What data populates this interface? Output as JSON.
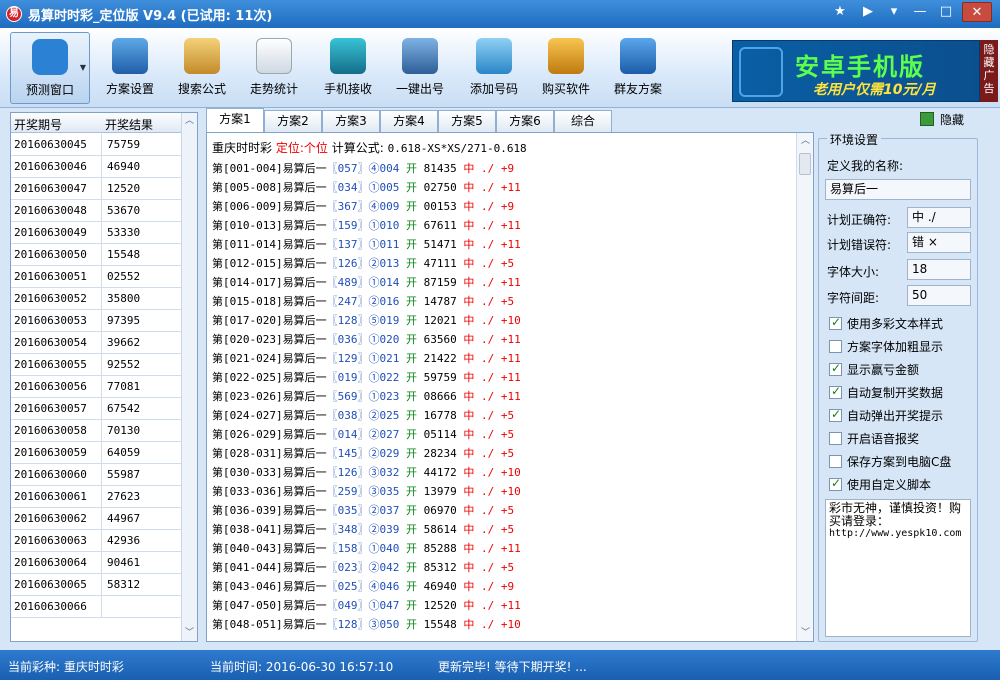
{
  "window": {
    "title": "易算时时彩_定位版 V9.4 (已试用: 11次)",
    "app_icon_glyph": "易"
  },
  "toolbar": {
    "items": [
      {
        "label": "预测窗口",
        "icon": "cloud-icon"
      },
      {
        "label": "方案设置",
        "icon": "settings-screen-icon"
      },
      {
        "label": "搜索公式",
        "icon": "clipboard-search-icon"
      },
      {
        "label": "走势统计",
        "icon": "trend-chart-icon"
      },
      {
        "label": "手机接收",
        "icon": "phone-icon"
      },
      {
        "label": "一键出号",
        "icon": "gear-settings-icon"
      },
      {
        "label": "添加号码",
        "icon": "folder-add-icon"
      },
      {
        "label": "购买软件",
        "icon": "key-icon"
      },
      {
        "label": "群友方案",
        "icon": "users-icon"
      }
    ]
  },
  "ad": {
    "main": "安卓手机版",
    "sub": "老用户仅需10元/月",
    "side": "隐藏广告"
  },
  "left_table": {
    "headers": [
      "开奖期号",
      "开奖结果"
    ],
    "rows": [
      [
        "20160630045",
        "75759"
      ],
      [
        "20160630046",
        "46940"
      ],
      [
        "20160630047",
        "12520"
      ],
      [
        "20160630048",
        "53670"
      ],
      [
        "20160630049",
        "53330"
      ],
      [
        "20160630050",
        "15548"
      ],
      [
        "20160630051",
        "02552"
      ],
      [
        "20160630052",
        "35800"
      ],
      [
        "20160630053",
        "97395"
      ],
      [
        "20160630054",
        "39662"
      ],
      [
        "20160630055",
        "92552"
      ],
      [
        "20160630056",
        "77081"
      ],
      [
        "20160630057",
        "67542"
      ],
      [
        "20160630058",
        "70130"
      ],
      [
        "20160630059",
        "64059"
      ],
      [
        "20160630060",
        "55987"
      ],
      [
        "20160630061",
        "27623"
      ],
      [
        "20160630062",
        "44967"
      ],
      [
        "20160630063",
        "42936"
      ],
      [
        "20160630064",
        "90461"
      ],
      [
        "20160630065",
        "58312"
      ],
      [
        "20160630066",
        ""
      ]
    ]
  },
  "tabs": [
    "方案1",
    "方案2",
    "方案3",
    "方案4",
    "方案5",
    "方案6",
    "综合"
  ],
  "active_tab": 0,
  "hide_label": "隐藏",
  "content": {
    "lottery": "重庆时时彩",
    "position_label": "定位:",
    "position_value": "个位",
    "formula_label": "计算公式:",
    "formula": "0.618-XS*XS/271-0.618",
    "rows": [
      {
        "period": "第[001-004]易算后一",
        "code": "〖057〗④004",
        "kai": "开",
        "num": "81435",
        "zh": "中",
        "mark": "./",
        "pts": "+9"
      },
      {
        "period": "第[005-008]易算后一",
        "code": "〖034〗①005",
        "kai": "开",
        "num": "02750",
        "zh": "中",
        "mark": "./",
        "pts": "+11"
      },
      {
        "period": "第[006-009]易算后一",
        "code": "〖367〗④009",
        "kai": "开",
        "num": "00153",
        "zh": "中",
        "mark": "./",
        "pts": "+9"
      },
      {
        "period": "第[010-013]易算后一",
        "code": "〖159〗①010",
        "kai": "开",
        "num": "67611",
        "zh": "中",
        "mark": "./",
        "pts": "+11"
      },
      {
        "period": "第[011-014]易算后一",
        "code": "〖137〗①011",
        "kai": "开",
        "num": "51471",
        "zh": "中",
        "mark": "./",
        "pts": "+11"
      },
      {
        "period": "第[012-015]易算后一",
        "code": "〖126〗②013",
        "kai": "开",
        "num": "47111",
        "zh": "中",
        "mark": "./",
        "pts": "+5"
      },
      {
        "period": "第[014-017]易算后一",
        "code": "〖489〗①014",
        "kai": "开",
        "num": "87159",
        "zh": "中",
        "mark": "./",
        "pts": "+11"
      },
      {
        "period": "第[015-018]易算后一",
        "code": "〖247〗②016",
        "kai": "开",
        "num": "14787",
        "zh": "中",
        "mark": "./",
        "pts": "+5"
      },
      {
        "period": "第[017-020]易算后一",
        "code": "〖128〗⑤019",
        "kai": "开",
        "num": "12021",
        "zh": "中",
        "mark": "./",
        "pts": "+10"
      },
      {
        "period": "第[020-023]易算后一",
        "code": "〖036〗①020",
        "kai": "开",
        "num": "63560",
        "zh": "中",
        "mark": "./",
        "pts": "+11"
      },
      {
        "period": "第[021-024]易算后一",
        "code": "〖129〗①021",
        "kai": "开",
        "num": "21422",
        "zh": "中",
        "mark": "./",
        "pts": "+11"
      },
      {
        "period": "第[022-025]易算后一",
        "code": "〖019〗①022",
        "kai": "开",
        "num": "59759",
        "zh": "中",
        "mark": "./",
        "pts": "+11"
      },
      {
        "period": "第[023-026]易算后一",
        "code": "〖569〗①023",
        "kai": "开",
        "num": "08666",
        "zh": "中",
        "mark": "./",
        "pts": "+11"
      },
      {
        "period": "第[024-027]易算后一",
        "code": "〖038〗②025",
        "kai": "开",
        "num": "16778",
        "zh": "中",
        "mark": "./",
        "pts": "+5"
      },
      {
        "period": "第[026-029]易算后一",
        "code": "〖014〗②027",
        "kai": "开",
        "num": "05114",
        "zh": "中",
        "mark": "./",
        "pts": "+5"
      },
      {
        "period": "第[028-031]易算后一",
        "code": "〖145〗②029",
        "kai": "开",
        "num": "28234",
        "zh": "中",
        "mark": "./",
        "pts": "+5"
      },
      {
        "period": "第[030-033]易算后一",
        "code": "〖126〗③032",
        "kai": "开",
        "num": "44172",
        "zh": "中",
        "mark": "./",
        "pts": "+10"
      },
      {
        "period": "第[033-036]易算后一",
        "code": "〖259〗③035",
        "kai": "开",
        "num": "13979",
        "zh": "中",
        "mark": "./",
        "pts": "+10"
      },
      {
        "period": "第[036-039]易算后一",
        "code": "〖035〗②037",
        "kai": "开",
        "num": "06970",
        "zh": "中",
        "mark": "./",
        "pts": "+5"
      },
      {
        "period": "第[038-041]易算后一",
        "code": "〖348〗②039",
        "kai": "开",
        "num": "58614",
        "zh": "中",
        "mark": "./",
        "pts": "+5"
      },
      {
        "period": "第[040-043]易算后一",
        "code": "〖158〗①040",
        "kai": "开",
        "num": "85288",
        "zh": "中",
        "mark": "./",
        "pts": "+11"
      },
      {
        "period": "第[041-044]易算后一",
        "code": "〖023〗②042",
        "kai": "开",
        "num": "85312",
        "zh": "中",
        "mark": "./",
        "pts": "+5"
      },
      {
        "period": "第[043-046]易算后一",
        "code": "〖025〗④046",
        "kai": "开",
        "num": "46940",
        "zh": "中",
        "mark": "./",
        "pts": "+9"
      },
      {
        "period": "第[047-050]易算后一",
        "code": "〖049〗①047",
        "kai": "开",
        "num": "12520",
        "zh": "中",
        "mark": "./",
        "pts": "+11"
      },
      {
        "period": "第[048-051]易算后一",
        "code": "〖128〗③050",
        "kai": "开",
        "num": "15548",
        "zh": "中",
        "mark": "./",
        "pts": "+10"
      }
    ]
  },
  "settings": {
    "legend": "环境设置",
    "name_label": "定义我的名称:",
    "name_value": "易算后一",
    "correct_label": "计划正确符:",
    "correct_value": "中 ./",
    "wrong_label": "计划错误符:",
    "wrong_value": "错 ×",
    "fontsize_label": "字体大小:",
    "fontsize_value": "18",
    "spacing_label": "字符间距:",
    "spacing_value": "50",
    "checks": [
      {
        "label": "使用多彩文本样式",
        "checked": true
      },
      {
        "label": "方案字体加粗显示",
        "checked": false
      },
      {
        "label": "显示赢亏金额",
        "checked": true
      },
      {
        "label": "自动复制开奖数据",
        "checked": true
      },
      {
        "label": "自动弹出开奖提示",
        "checked": true
      },
      {
        "label": "开启语音报奖",
        "checked": false
      },
      {
        "label": "保存方案到电脑C盘",
        "checked": false
      },
      {
        "label": "使用自定义脚本",
        "checked": true
      }
    ],
    "notes": "彩市无神，谨慎投资！购买请登录：",
    "notes_url": "http://www.yespk10.com"
  },
  "status": {
    "lottery": "当前彩种: 重庆时时彩",
    "time": "当前时间: 2016-06-30 16:57:10",
    "message": "更新完毕! 等待下期开奖! ..."
  },
  "colors": {
    "titlebar": "#1f6cc0",
    "statusbar": "#1a5fb0",
    "hit_red": "#ee0000",
    "kai_green": "#0a8a19",
    "code_blue": "#1f4fb8",
    "ad_green": "#5cff4c",
    "ad_yellow": "#ffe33a"
  }
}
